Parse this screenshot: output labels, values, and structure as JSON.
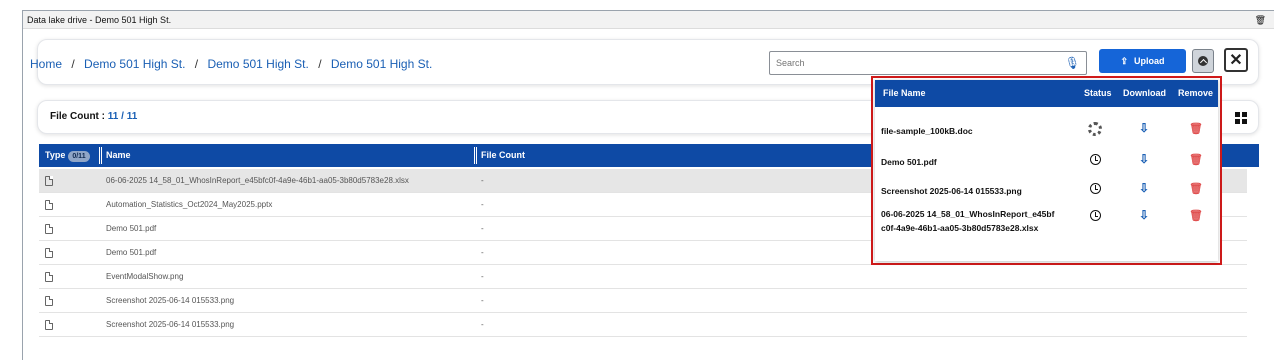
{
  "window": {
    "title": "Data lake drive - Demo 501 High St."
  },
  "breadcrumb": [
    "Home",
    "Demo 501 High St.",
    "Demo 501 High St.",
    "Demo 501 High St."
  ],
  "breadcrumb_sep": "/",
  "search": {
    "placeholder": "Search",
    "value": ""
  },
  "toolbar": {
    "upload_label": "Upload",
    "close_label": "✕"
  },
  "file_count": {
    "label": "File Count :",
    "value": "11 / 11"
  },
  "table": {
    "headers": {
      "type": "Type",
      "type_badge": "0/11",
      "name": "Name",
      "file_count": "File Count"
    },
    "rows": [
      {
        "icon": "excel-file-icon",
        "name": "06-06-2025 14_58_01_WhosInReport_e45bfc0f-4a9e-46b1-aa05-3b80d5783e28.xlsx",
        "count": "-",
        "selected": true
      },
      {
        "icon": "powerpoint-file-icon",
        "name": "Automation_Statistics_Oct2024_May2025.pptx",
        "count": "-"
      },
      {
        "icon": "pdf-file-icon",
        "name": "Demo 501.pdf",
        "count": "-"
      },
      {
        "icon": "pdf-file-icon",
        "name": "Demo 501.pdf",
        "count": "-"
      },
      {
        "icon": "image-file-icon",
        "name": "EventModalShow.png",
        "count": "-"
      },
      {
        "icon": "image-file-icon",
        "name": "Screenshot 2025-06-14 015533.png",
        "count": "-"
      },
      {
        "icon": "image-file-icon",
        "name": "Screenshot 2025-06-14 015533.png",
        "count": "-"
      }
    ]
  },
  "upload_panel": {
    "headers": {
      "name": "File Name",
      "status": "Status",
      "download": "Download",
      "remove": "Remove"
    },
    "rows": [
      {
        "name": "file-sample_100kB.doc",
        "status": "loading-spinner-icon"
      },
      {
        "name": "Demo 501.pdf",
        "status": "clock-icon"
      },
      {
        "name": "Screenshot 2025-06-14 015533.png",
        "status": "clock-icon"
      },
      {
        "name": "06-06-2025 14_58_01_WhosInReport_e45bfc0f-4a9e-46b1-aa05-3b80d5783e28.xlsx",
        "status": "clock-icon"
      }
    ]
  },
  "colors": {
    "accent": "#1565d8",
    "header_bg": "#0e4aa5",
    "highlight_border": "#d11a1a",
    "remove": "#e05050"
  }
}
